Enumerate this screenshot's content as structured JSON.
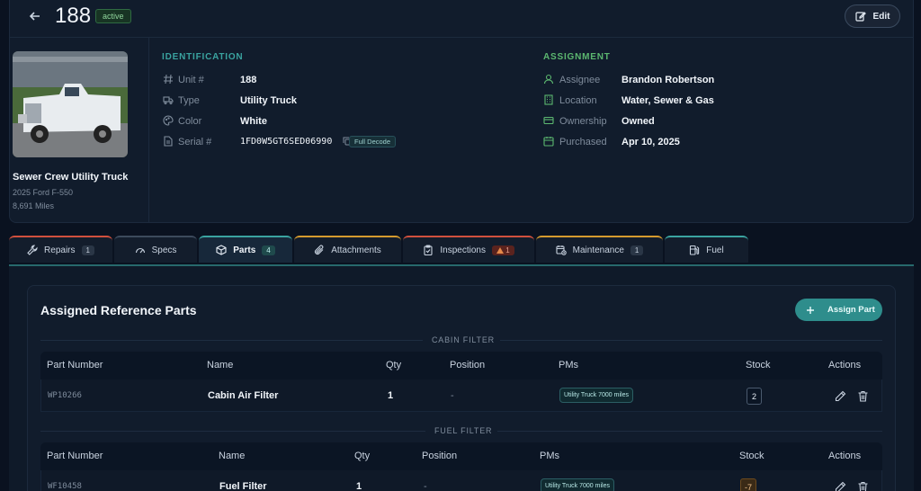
{
  "header": {
    "unit_title": "188",
    "status": "active",
    "edit_label": "Edit"
  },
  "vehicle": {
    "name": "Sewer Crew Utility Truck",
    "model": "2025 Ford F-550",
    "miles": "8,691 Miles"
  },
  "identification": {
    "title": "IDENTIFICATION",
    "fields": [
      {
        "label": "Unit #",
        "value": "188",
        "icon": "hash-icon"
      },
      {
        "label": "Type",
        "value": "Utility Truck",
        "icon": "truck-icon"
      },
      {
        "label": "Color",
        "value": "White",
        "icon": "palette-icon"
      },
      {
        "label": "Serial #",
        "value": "1FD0W5GT6SED06990",
        "icon": "document-icon"
      }
    ],
    "decode_label": "Full Decode"
  },
  "assignment": {
    "title": "ASSIGNMENT",
    "fields": [
      {
        "label": "Assignee",
        "value": "Brandon Robertson",
        "icon": "user-icon"
      },
      {
        "label": "Location",
        "value": "Water, Sewer & Gas",
        "icon": "building-icon"
      },
      {
        "label": "Ownership",
        "value": "Owned",
        "icon": "card-icon"
      },
      {
        "label": "Purchased",
        "value": "Apr 10, 2025",
        "icon": "calendar-icon"
      }
    ]
  },
  "tabs": [
    {
      "label": "Repairs",
      "count": "1"
    },
    {
      "label": "Specs"
    },
    {
      "label": "Parts",
      "count": "4"
    },
    {
      "label": "Attachments"
    },
    {
      "label": "Inspections",
      "count": "1"
    },
    {
      "label": "Maintenance",
      "count": "1"
    },
    {
      "label": "Fuel"
    }
  ],
  "colors": {
    "accent_teal": "#2e8d8c",
    "repairs_tab": "#d0503d",
    "specs_tab": "#3c4a5c",
    "parts_tab": "#3aa3a0",
    "attachments_tab": "#d59a2e",
    "inspections_tab": "#d0503d",
    "maintenance_tab": "#d59a2e",
    "fuel_tab": "#3aa3a0",
    "identification_title": "#3aa3a0",
    "assignment_title": "#5cb870"
  },
  "parts": {
    "title": "Assigned Reference Parts",
    "assign_label": "Assign Part",
    "columns": [
      "Part Number",
      "Name",
      "Qty",
      "Position",
      "PMs",
      "Stock",
      "Actions"
    ],
    "groups": [
      {
        "label": "CABIN FILTER",
        "rows": [
          {
            "part_number": "WP10266",
            "name": "Cabin Air Filter",
            "qty": "1",
            "position": "-",
            "pm": "Utility Truck 7000 miles",
            "stock": "2"
          }
        ]
      },
      {
        "label": "FUEL FILTER",
        "rows": [
          {
            "part_number": "WF10458",
            "name": "Fuel Filter",
            "qty": "1",
            "position": "-",
            "pm": "Utility Truck 7000 miles",
            "stock": "-7"
          }
        ]
      }
    ]
  }
}
